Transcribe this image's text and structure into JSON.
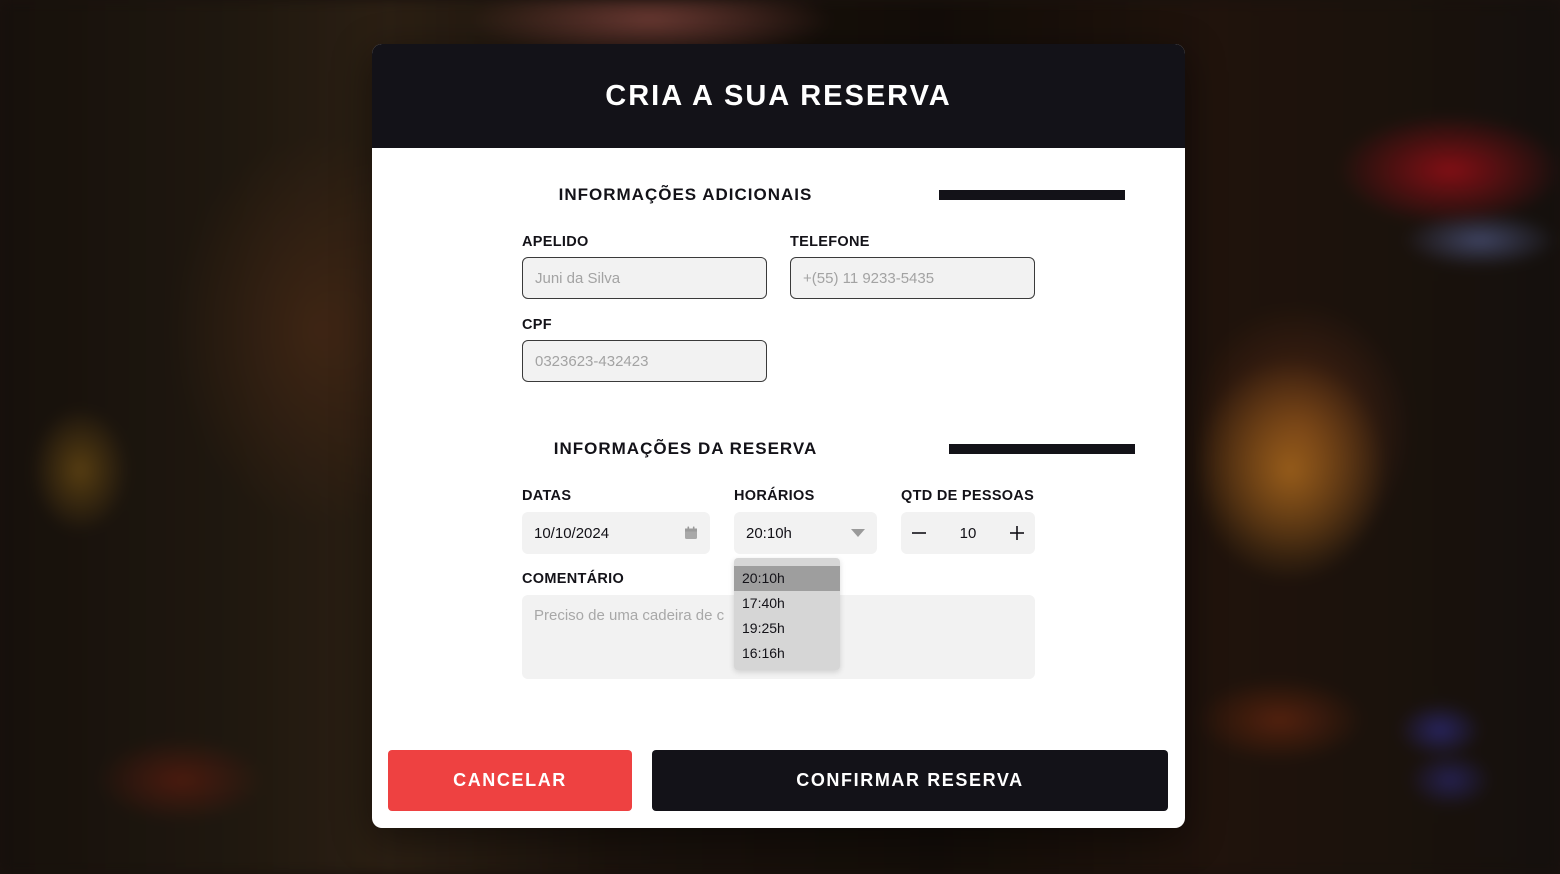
{
  "modal": {
    "title": "CRIA A SUA RESERVA"
  },
  "additional_info": {
    "section_title": "INFORMAÇÕES ADICIONAIS",
    "nickname": {
      "label": "APELIDO",
      "placeholder": "Juni da Silva",
      "value": ""
    },
    "phone": {
      "label": "TELEFONE",
      "placeholder": "+(55) 11 9233-5435",
      "value": ""
    },
    "cpf": {
      "label": "CPF",
      "placeholder": "0323623-432423",
      "value": ""
    }
  },
  "reservation_info": {
    "section_title": "INFORMAÇÕES DA RESERVA",
    "dates": {
      "label": "DATAS",
      "value": "10/10/2024",
      "icon": "calendar-icon"
    },
    "times": {
      "label": "HORÁRIOS",
      "selected": "20:10h",
      "icon": "chevron-down-icon",
      "options": [
        "20:10h",
        "17:40h",
        "19:25h",
        "16:16h"
      ]
    },
    "people": {
      "label": "QTD DE PESSOAS",
      "value": "10",
      "minus_icon": "minus-icon",
      "plus_icon": "plus-icon"
    },
    "comment": {
      "label": "COMENTÁRIO",
      "placeholder": "Preciso de uma cadeira de c",
      "value": ""
    }
  },
  "actions": {
    "cancel_label": "CANCELAR",
    "confirm_label": "CONFIRMAR RESERVA"
  },
  "colors": {
    "header_bg": "#131218",
    "cancel_bg": "#ee4141",
    "confirm_bg": "#131218",
    "field_bg": "#f2f2f2",
    "dropdown_bg": "#d6d6d6",
    "dropdown_selected_bg": "#9e9e9e"
  }
}
